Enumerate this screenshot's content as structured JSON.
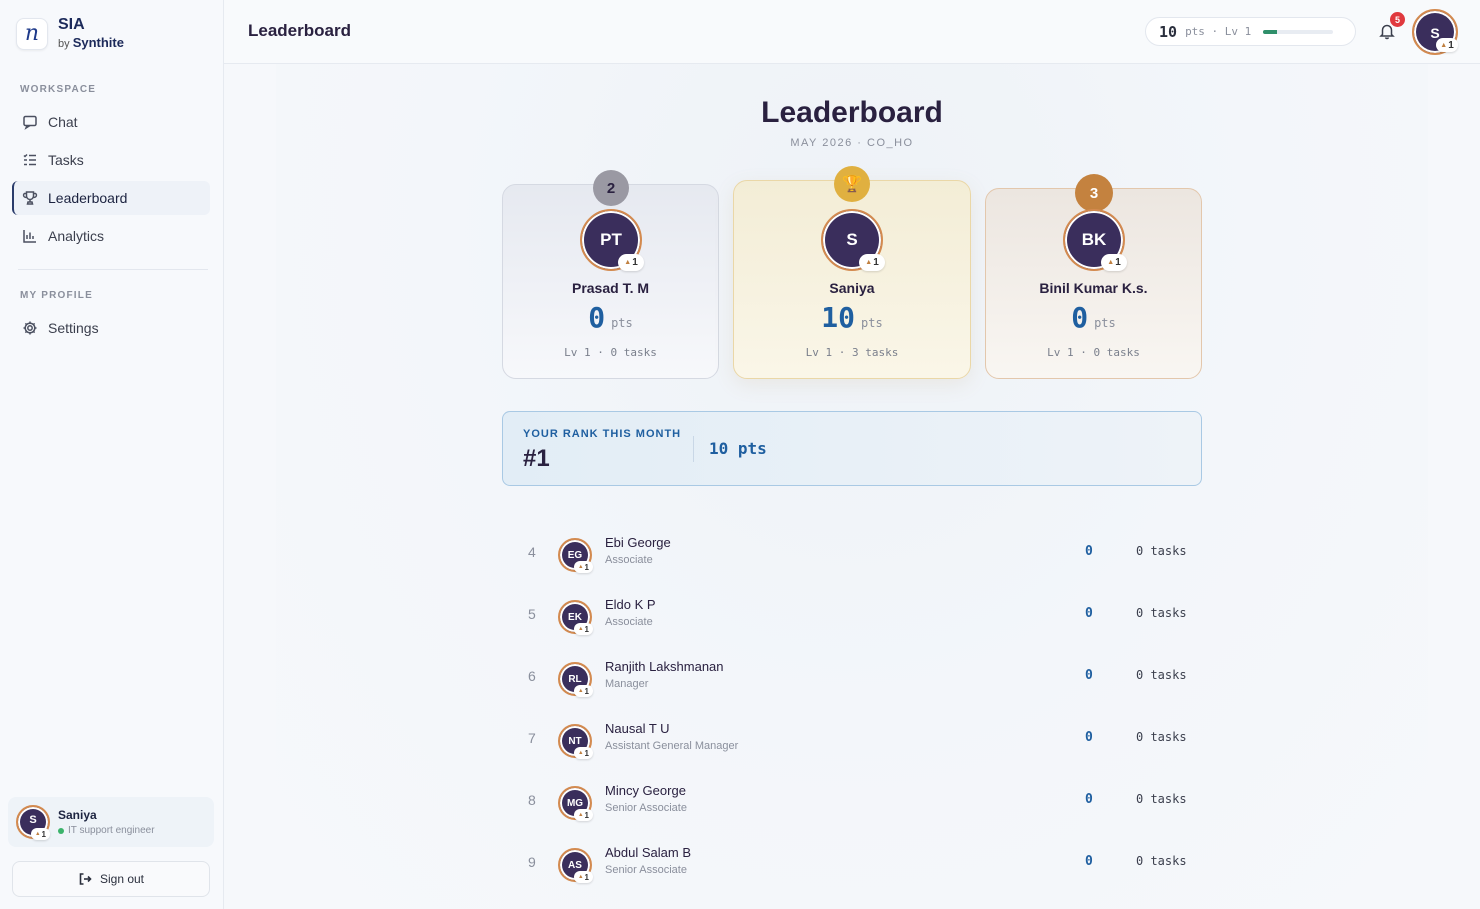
{
  "brand": {
    "name": "SIA",
    "by": "by",
    "company": "Synthite",
    "logo_letter": "n"
  },
  "sidebar": {
    "workspace_label": "WORKSPACE",
    "items": [
      {
        "label": "Chat",
        "icon": "chat-icon"
      },
      {
        "label": "Tasks",
        "icon": "tasks-icon"
      },
      {
        "label": "Leaderboard",
        "icon": "trophy-icon",
        "active": true
      },
      {
        "label": "Analytics",
        "icon": "analytics-icon"
      }
    ],
    "profile_label": "MY PROFILE",
    "settings_label": "Settings",
    "user": {
      "initials": "S",
      "level": "1",
      "name": "Saniya",
      "role": "IT support engineer"
    },
    "signout_label": "Sign out"
  },
  "header": {
    "title": "Leaderboard",
    "points": "10",
    "points_label": "pts · Lv 1",
    "level_progress": 0.2,
    "notification_count": "5",
    "user_initials": "S",
    "user_level": "1"
  },
  "leaderboard": {
    "title": "Leaderboard",
    "subtitle": "MAY 2026 · CO_HO",
    "pts_unit": "pts",
    "podium": [
      {
        "rank": "2",
        "initials": "PT",
        "level": "1",
        "name": "Prasad T. M",
        "points": "0",
        "meta": "Lv 1 · 0 tasks"
      },
      {
        "rank": "🏆",
        "initials": "S",
        "level": "1",
        "name": "Saniya",
        "points": "10",
        "meta": "Lv 1 · 3 tasks"
      },
      {
        "rank": "3",
        "initials": "BK",
        "level": "1",
        "name": "Binil Kumar K.s.",
        "points": "0",
        "meta": "Lv 1 · 0 tasks"
      }
    ],
    "your_rank": {
      "label": "YOUR RANK THIS MONTH",
      "rank": "#1",
      "points": "10 pts"
    },
    "rows": [
      {
        "rank": "4",
        "initials": "EG",
        "level": "1",
        "name": "Ebi George",
        "role": "Associate",
        "points": "0",
        "tasks": "0 tasks"
      },
      {
        "rank": "5",
        "initials": "EK",
        "level": "1",
        "name": "Eldo K P",
        "role": "Associate",
        "points": "0",
        "tasks": "0 tasks"
      },
      {
        "rank": "6",
        "initials": "RL",
        "level": "1",
        "name": "Ranjith Lakshmanan",
        "role": "Manager",
        "points": "0",
        "tasks": "0 tasks"
      },
      {
        "rank": "7",
        "initials": "NT",
        "level": "1",
        "name": "Nausal T U",
        "role": "Assistant General Manager",
        "points": "0",
        "tasks": "0 tasks"
      },
      {
        "rank": "8",
        "initials": "MG",
        "level": "1",
        "name": "Mincy George",
        "role": "Senior Associate",
        "points": "0",
        "tasks": "0 tasks"
      },
      {
        "rank": "9",
        "initials": "AS",
        "level": "1",
        "name": "Abdul Salam B",
        "role": "Senior Associate",
        "points": "0",
        "tasks": "0 tasks"
      }
    ]
  },
  "colors": {
    "accent": "#1f5fa0",
    "avatar_bg": "#3a2e5c",
    "avatar_ring": "#d38a4f",
    "gold": "#e0b040",
    "silver": "#9a99a3",
    "bronze": "#c4823f"
  }
}
